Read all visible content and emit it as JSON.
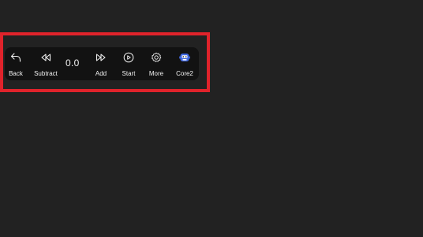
{
  "colors": {
    "background": "#222222",
    "toolbar_background": "#121212",
    "highlight_border": "#e0232b",
    "text": "#f2f2f2",
    "core_icon_accent": "#4169e1"
  },
  "toolbar": {
    "back": {
      "label": "Back",
      "icon": "back-arrow-icon"
    },
    "subtract": {
      "label": "Subtract",
      "icon": "rewind-icon"
    },
    "value": "0.0",
    "add": {
      "label": "Add",
      "icon": "fast-forward-icon"
    },
    "start": {
      "label": "Start",
      "icon": "play-circle-icon"
    },
    "more": {
      "label": "More",
      "icon": "gear-icon"
    },
    "core": {
      "label": "Core2",
      "icon": "robot-icon"
    }
  }
}
